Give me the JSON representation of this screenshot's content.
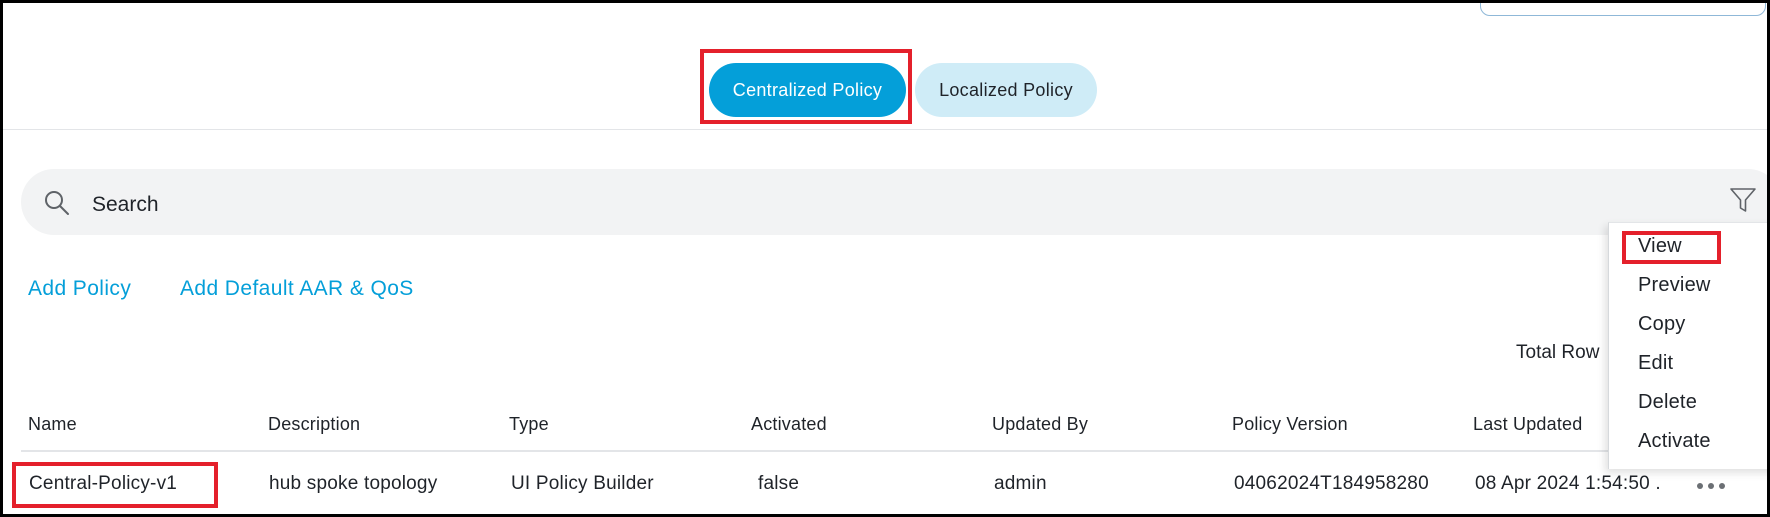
{
  "tabs": {
    "centralized_label": "Centralized Policy",
    "localized_label": "Localized Policy"
  },
  "search": {
    "placeholder": "Search"
  },
  "actions": {
    "add_policy": "Add Policy",
    "add_default": "Add Default AAR & QoS"
  },
  "total_rows_label": "Total Row",
  "table": {
    "columns": [
      "Name",
      "Description",
      "Type",
      "Activated",
      "Updated By",
      "Policy Version",
      "Last Updated"
    ],
    "rows": [
      [
        "Central-Policy-v1",
        "hub spoke topology",
        "UI Policy Builder",
        "false",
        "admin",
        "04062024T184958280",
        "08 Apr 2024 1:54:50 ."
      ]
    ]
  },
  "context_menu": {
    "items": [
      "View",
      "Preview",
      "Copy",
      "Edit",
      "Delete",
      "Activate"
    ]
  },
  "colors": {
    "accent": "#049fd9",
    "accent_light": "#cfecf7",
    "annotation_red": "#e4202b"
  }
}
